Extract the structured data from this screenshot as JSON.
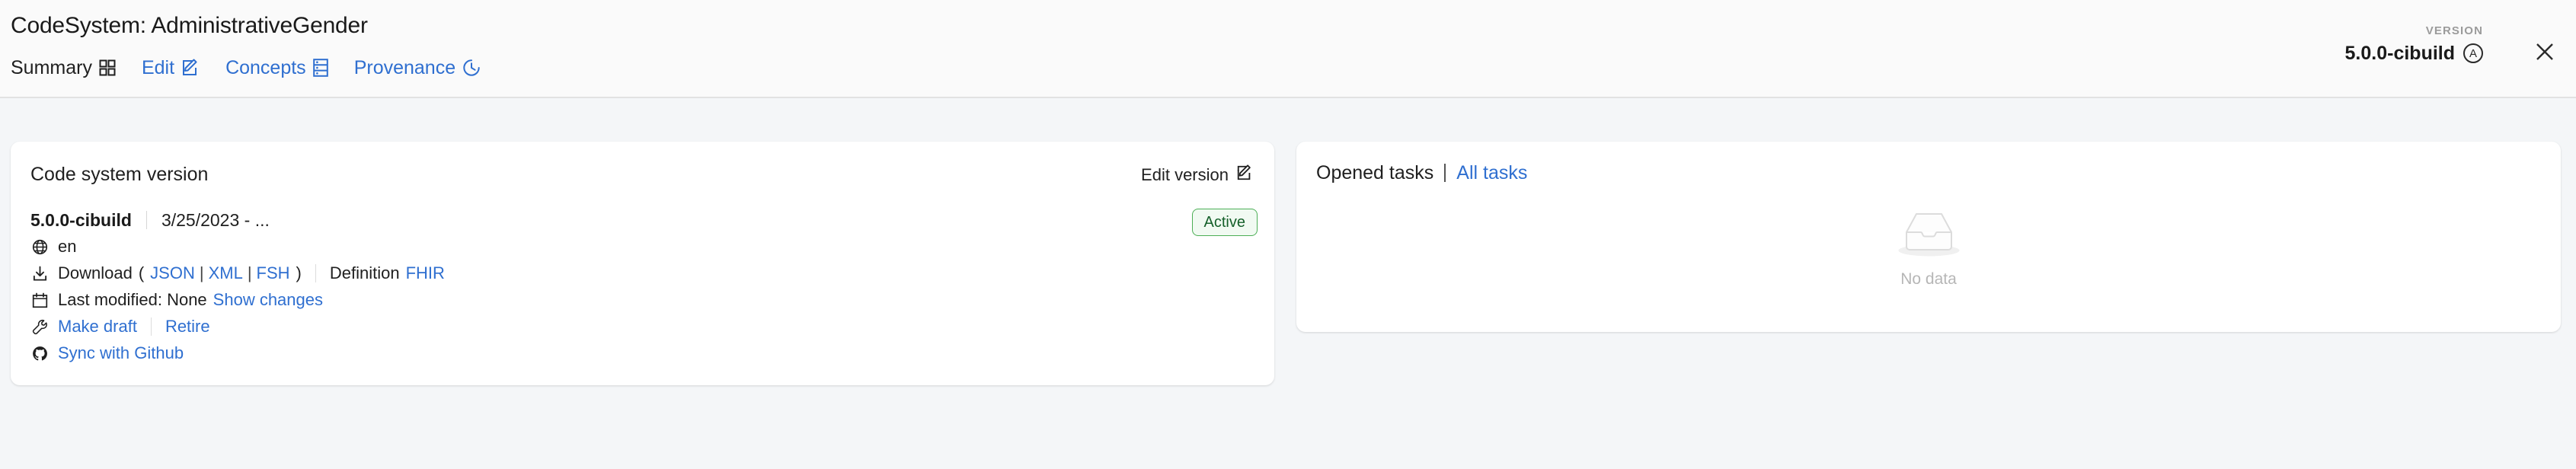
{
  "header": {
    "title": "CodeSystem: AdministrativeGender",
    "tabs": [
      {
        "label": "Summary",
        "icon": "grid-icon",
        "active": true
      },
      {
        "label": "Edit",
        "icon": "pencil-square-icon",
        "active": false
      },
      {
        "label": "Concepts",
        "icon": "database-list-icon",
        "active": false
      },
      {
        "label": "Provenance",
        "icon": "clock-history-icon",
        "active": false
      }
    ],
    "version_kicker": "VERSION",
    "version_value": "5.0.0-cibuild",
    "version_badge_letter": "A",
    "close_label": "×"
  },
  "left_card": {
    "title": "Code system version",
    "edit_version_label": "Edit version",
    "status_badge": "Active",
    "version_number": "5.0.0-cibuild",
    "version_date": "3/25/2023 - ...",
    "language": "en",
    "download_label": "Download",
    "paren_open": "(",
    "paren_close": ")",
    "download_formats": [
      "JSON",
      "XML",
      "FSH"
    ],
    "definition_label": "Definition",
    "definition_value": "FHIR",
    "last_modified_label": "Last modified: None",
    "show_changes_label": "Show changes",
    "make_draft_label": "Make draft",
    "retire_label": "Retire",
    "sync_github_label": "Sync with Github"
  },
  "right_card": {
    "opened_tasks_label": "Opened tasks",
    "all_tasks_label": "All tasks",
    "empty_state_label": "No data"
  },
  "colors": {
    "link": "#2f6fd0",
    "text": "#1f1f1f",
    "muted": "#9b9b9b",
    "badge_border": "#4caf56",
    "badge_bg": "#f1faf2",
    "badge_text": "#15602a",
    "page_bg": "#f4f6f8",
    "header_bg": "#fafafa",
    "card_bg": "#ffffff"
  }
}
